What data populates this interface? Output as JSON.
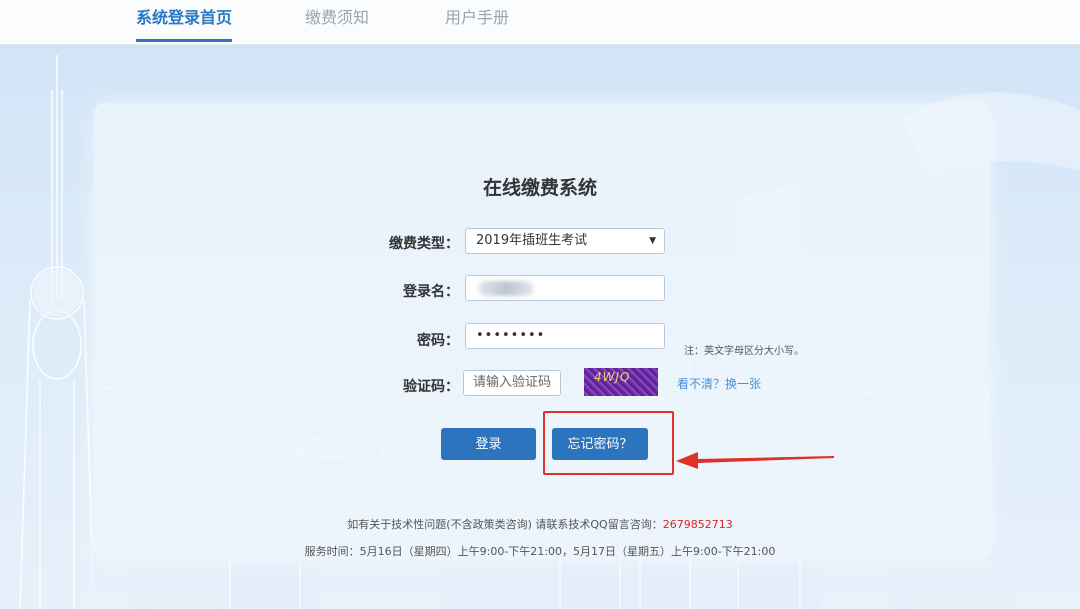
{
  "nav": {
    "items": [
      {
        "label": "系统登录首页",
        "active": true
      },
      {
        "label": "缴费须知",
        "active": false
      },
      {
        "label": "用户手册",
        "active": false
      }
    ]
  },
  "form": {
    "title": "在线缴费系统",
    "type_label": "缴费类型：",
    "type_value": "2019年插班生考试",
    "login_label": "登录名：",
    "password_label": "密码：",
    "password_value": "••••••••",
    "password_note": "注：英文字母区分大小写。",
    "captcha_label": "验证码：",
    "captcha_placeholder": "请输入验证码",
    "captcha_image_text": "4WJQ",
    "captcha_refresh": "看不清？换一张",
    "login_button": "登录",
    "forgot_button": "忘记密码？"
  },
  "footer": {
    "line1_prefix": "如有关于技术性问题(不含政策类咨询)   请联系技术QQ留言咨询：",
    "qq_number": "2679852713",
    "line2": "服务时间：5月16日（星期四）上午9:00-下午21:00，5月17日（星期五）上午9:00-下午21:00"
  },
  "colors": {
    "accent": "#2b78c5",
    "button": "#2c74bd",
    "annotation": "#e0302a",
    "qq": "#d9271f"
  }
}
